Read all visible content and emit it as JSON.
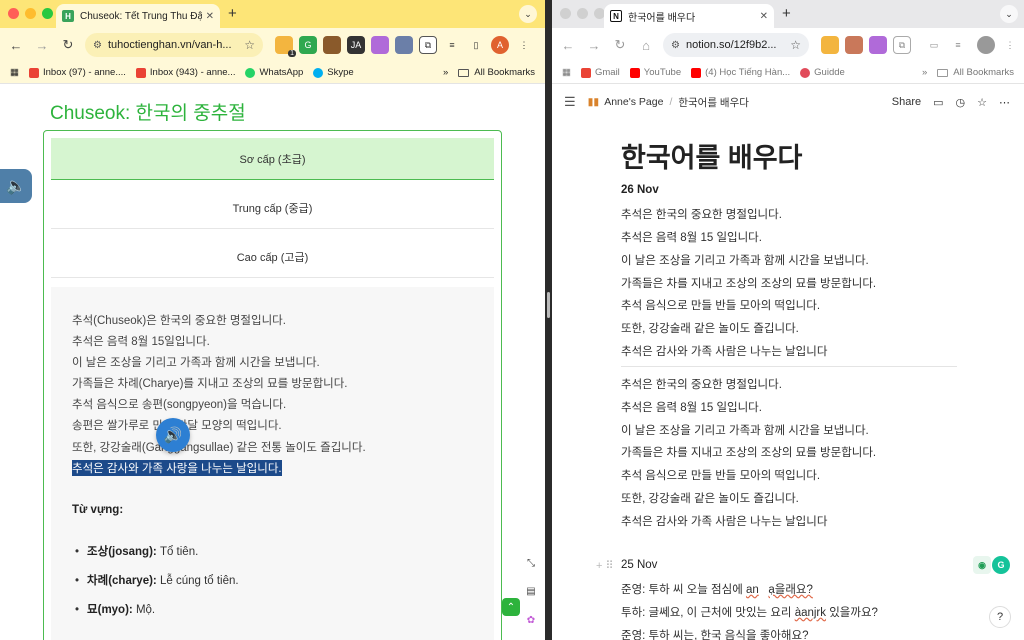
{
  "left": {
    "tab": {
      "title": "Chuseok: Tết Trung Thu Đậm",
      "favicon_letter": "H"
    },
    "url": "tuhoctienghan.vn/van-h...",
    "bookmarks": [
      "Inbox (97) - anne....",
      "Inbox (943) - anne...",
      "WhatsApp",
      "Skype"
    ],
    "bookmarks_more": "»",
    "all_bookmarks": "All Bookmarks",
    "extension_badge": "1",
    "profile_letter": "A",
    "page": {
      "heading": "Chuseok: 한국의 중추절",
      "levels": [
        "Sơ cấp (초급)",
        "Trung cấp (중급)",
        "Cao cấp (고급)"
      ],
      "sentences": [
        "추석(Chuseok)은 한국의 중요한 명절입니다.",
        "추석은 음력 8월 15일입니다.",
        "이 날은 조상을 기리고 가족과 함께 시간을 보냅니다.",
        "가족들은 차례(Charye)를 지내고 조상의 묘를 방문합니다.",
        "추석 음식으로 송편(songpyeon)을 먹습니다.",
        "송편은 쌀가루로 만든 반달 모양의 떡입니다.",
        "또한, 강강술래(Ganggangsullae) 같은 전통 놀이도 즐깁니다.",
        "추석은 감사와 가족 사랑을 나누는 날입니다."
      ],
      "vocab_heading": "Từ vựng:",
      "vocab": [
        {
          "term": "조상(josang):",
          "meaning": " Tổ tiên."
        },
        {
          "term": "차례(charye):",
          "meaning": " Lễ cúng tổ tiên."
        },
        {
          "term": "묘(myo):",
          "meaning": " Mộ."
        }
      ]
    }
  },
  "right": {
    "tab": {
      "title": "한국어를 배우다",
      "favicon_letter": "N"
    },
    "url": "notion.so/12f9b2...",
    "bookmarks": [
      "Gmail",
      "YouTube",
      "(4) Học Tiếng Hàn...",
      "Guidde"
    ],
    "bookmarks_more": "»",
    "all_bookmarks": "All Bookmarks",
    "breadcrumb": [
      "Anne's Page",
      "한국어를 배우다"
    ],
    "share_label": "Share",
    "page_title": "한국어를 배우다",
    "section1_date": "26 Nov",
    "section1_lines": [
      "추석은 한국의 중요한 명절입니다.",
      "추석은 음력 8월 15 일입니다.",
      "이 날은 조상을 기리고 가족과 함께 시간을 보냅니다.",
      "가족들은 차를 지내고 조상의 조상의 묘를 방문합니다.",
      "추석 음식으로 만들 반들 모아의 떡입니다.",
      "또한, 강강술래 같은 놀이도 즐깁니다.",
      "추석은 감사와 가족 사람은 나누는 날입니다"
    ],
    "section2_lines": [
      "추석은 한국의 중요한 명절입니다.",
      "추석은 음력 8월 15 일입니다.",
      "이 날은 조상을 기리고 가족과 함께 시간을 보냅니다.",
      "가족들은 차를 지내고 조상의 조상의 묘를 방문합니다.",
      "추석 음식으로 만들 반들 모아의 떡입니다.",
      "또한, 강강술래 같은 놀이도 즐깁니다.",
      "추석은 감사와 가족 사람은 나누는 날입니다"
    ],
    "section3_date": "25 Nov",
    "dialogue": [
      "준영: 투하 씨 오늘 점심에 ",
      "투하: 글쎄요, 이 근처에 맛있는   요리 ",
      "준영: 투하 씨는, 한국 음식을 좋아해요?"
    ],
    "dialogue_misspelled": [
      "an",
      "ạ을래요?",
      "àanjrk",
      " 있을까요?"
    ]
  },
  "colors": {
    "left_tabstrip": "#fde577",
    "green_accent": "#4cbb50",
    "heading_green": "#2db33c",
    "highlight": "#1c4a8a",
    "speaker_blue": "#2d7fd3"
  },
  "icons": [
    "back-icon",
    "forward-icon",
    "reload-icon",
    "star-icon",
    "extensions-icon",
    "menu-dots-icon",
    "speaker-icon",
    "hamburger-icon",
    "comment-icon",
    "clock-icon",
    "grammarly-icon",
    "help-icon"
  ]
}
